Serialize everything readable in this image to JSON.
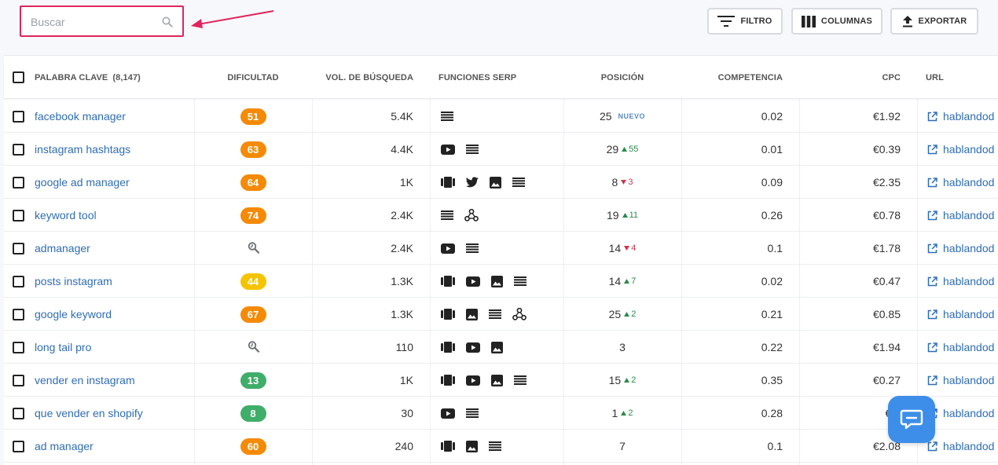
{
  "search": {
    "placeholder": "Buscar",
    "value": ""
  },
  "toolbar": {
    "filter_label": "FILTRO",
    "columns_label": "COLUMNAS",
    "export_label": "EXPORTAR"
  },
  "columns": {
    "keyword": "PALABRA CLAVE",
    "keyword_count": "(8,147)",
    "difficulty": "DIFICULTAD",
    "volume": "VOL. DE BÚSQUEDA",
    "serp": "FUNCIONES SERP",
    "position": "POSICIÓN",
    "competition": "COMPETENCIA",
    "cpc": "CPC",
    "url": "URL"
  },
  "colors": {
    "accent": "#2f6db5",
    "highlight": "#e0245e",
    "up": "#2a8a4a",
    "down": "#d0344a",
    "diff_easy": "#3fae6a",
    "diff_mid": "#f5c400",
    "diff_hard": "#f58a07"
  },
  "rows": [
    {
      "keyword": "facebook manager",
      "difficulty": "51",
      "volume": "5.4K",
      "serp": [
        "list-icon"
      ],
      "position": "25",
      "change_dir": "new",
      "change": "NUEVO",
      "competition": "0.02",
      "cpc": "€1.92",
      "url": "hablandod"
    },
    {
      "keyword": "instagram hashtags",
      "difficulty": "63",
      "volume": "4.4K",
      "serp": [
        "video-icon",
        "list-icon"
      ],
      "position": "29",
      "change_dir": "up",
      "change": "55",
      "competition": "0.01",
      "cpc": "€0.39",
      "url": "hablandod"
    },
    {
      "keyword": "google ad manager",
      "difficulty": "64",
      "volume": "1K",
      "serp": [
        "carousel-icon",
        "twitter-icon",
        "image-icon",
        "list-icon"
      ],
      "position": "8",
      "change_dir": "down",
      "change": "3",
      "competition": "0.09",
      "cpc": "€2.35",
      "url": "hablandod"
    },
    {
      "keyword": "keyword tool",
      "difficulty": "74",
      "volume": "2.4K",
      "serp": [
        "list-icon",
        "knowledge-graph-icon"
      ],
      "position": "19",
      "change_dir": "up",
      "change": "11",
      "competition": "0.26",
      "cpc": "€0.78",
      "url": "hablandod"
    },
    {
      "keyword": "admanager",
      "difficulty": "",
      "difficulty_icon": "analyze-icon",
      "volume": "2.4K",
      "serp": [
        "video-icon",
        "list-icon"
      ],
      "position": "14",
      "change_dir": "down",
      "change": "4",
      "competition": "0.1",
      "cpc": "€1.78",
      "url": "hablandod"
    },
    {
      "keyword": "posts instagram",
      "difficulty": "44",
      "volume": "1.3K",
      "serp": [
        "carousel-icon",
        "video-icon",
        "image-icon",
        "list-icon"
      ],
      "position": "14",
      "change_dir": "up",
      "change": "7",
      "competition": "0.02",
      "cpc": "€0.47",
      "url": "hablandod"
    },
    {
      "keyword": "google keyword",
      "difficulty": "67",
      "volume": "1.3K",
      "serp": [
        "carousel-icon",
        "image-icon",
        "list-icon",
        "knowledge-graph-icon"
      ],
      "position": "25",
      "change_dir": "up",
      "change": "2",
      "competition": "0.21",
      "cpc": "€0.85",
      "url": "hablandod"
    },
    {
      "keyword": "long tail pro",
      "difficulty": "",
      "difficulty_icon": "analyze-icon",
      "volume": "110",
      "serp": [
        "carousel-icon",
        "video-icon",
        "image-icon"
      ],
      "position": "3",
      "change_dir": "",
      "change": "",
      "competition": "0.22",
      "cpc": "€1.94",
      "url": "hablandod"
    },
    {
      "keyword": "vender en instagram",
      "difficulty": "13",
      "volume": "1K",
      "serp": [
        "carousel-icon",
        "video-icon",
        "image-icon",
        "list-icon"
      ],
      "position": "15",
      "change_dir": "up",
      "change": "2",
      "competition": "0.35",
      "cpc": "€0.27",
      "url": "hablandod"
    },
    {
      "keyword": "que vender en shopify",
      "difficulty": "8",
      "volume": "30",
      "serp": [
        "video-icon",
        "list-icon"
      ],
      "position": "1",
      "change_dir": "up",
      "change": "2",
      "competition": "0.28",
      "cpc": "€0.",
      "url": "hablandod"
    },
    {
      "keyword": "ad manager",
      "difficulty": "60",
      "volume": "240",
      "serp": [
        "carousel-icon",
        "image-icon",
        "list-icon"
      ],
      "position": "7",
      "change_dir": "",
      "change": "",
      "competition": "0.1",
      "cpc": "€2.08",
      "url": "hablandod"
    }
  ]
}
